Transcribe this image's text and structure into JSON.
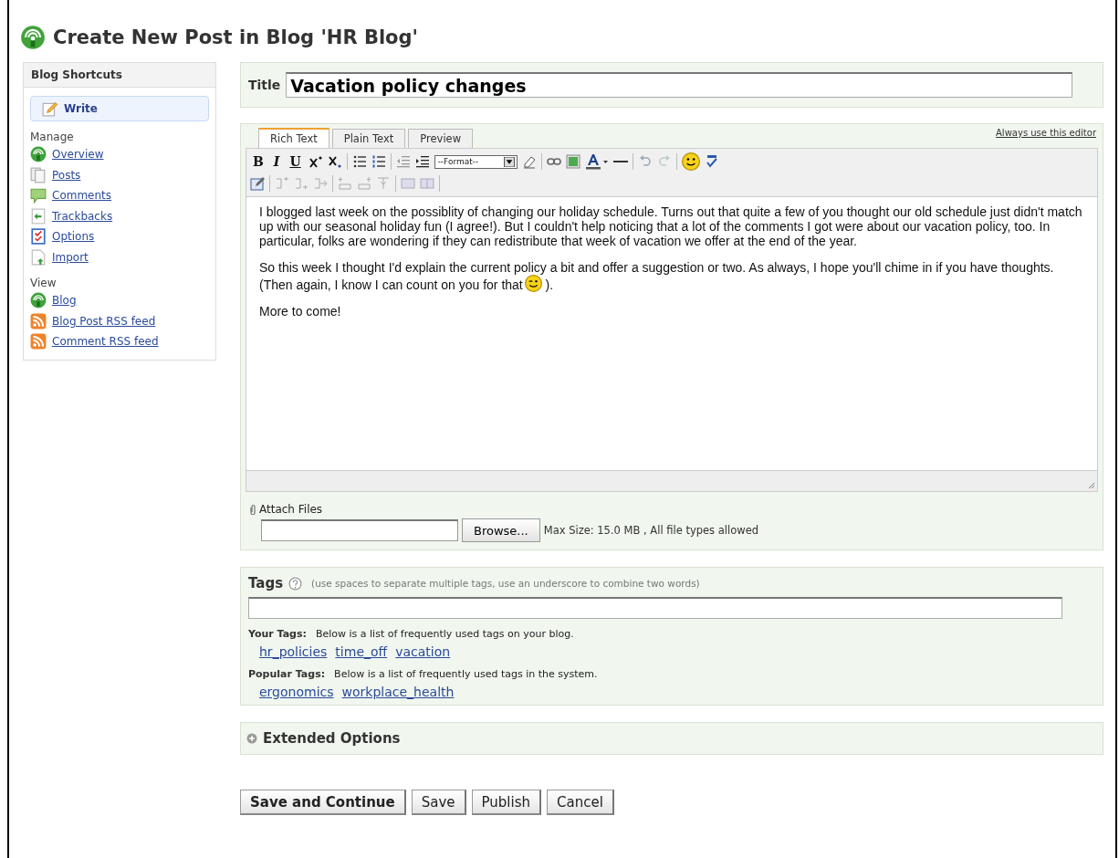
{
  "page_title": "Create New Post in Blog 'HR Blog'",
  "sidebar": {
    "heading": "Blog Shortcuts",
    "write": {
      "label": "Write",
      "selected": true
    },
    "sections": [
      {
        "label": "Manage",
        "items": [
          {
            "label": "Overview",
            "kind": "feed"
          },
          {
            "label": "Posts",
            "kind": "pages"
          },
          {
            "label": "Comments",
            "kind": "comment"
          },
          {
            "label": "Trackbacks",
            "kind": "trackback"
          },
          {
            "label": "Options",
            "kind": "options"
          },
          {
            "label": "Import",
            "kind": "import"
          }
        ]
      },
      {
        "label": "View",
        "items": [
          {
            "label": "Blog",
            "kind": "feed"
          },
          {
            "label": "Blog Post RSS feed",
            "kind": "rss"
          },
          {
            "label": "Comment RSS feed",
            "kind": "rss"
          }
        ]
      }
    ]
  },
  "title_field": {
    "label": "Title",
    "value": "Vacation policy changes"
  },
  "editor": {
    "tabs": [
      {
        "label": "Rich Text",
        "selected": true
      },
      {
        "label": "Plain Text",
        "selected": false
      },
      {
        "label": "Preview",
        "selected": false
      }
    ],
    "always_link": "Always use this editor",
    "format_select": "--Format--",
    "toolbar_letters": [
      "B",
      "I",
      "U"
    ],
    "paragraphs": [
      {
        "text": "I blogged last week on the possiblity of changing our holiday schedule. Turns out that quite a few of you thought our old schedule just didn't match up with our seasonal holiday fun (I agree!). But I couldn't help noticing that a lot of the comments I got were about our vacation policy, too. In particular, folks are wondering if they can redistribute that week of vacation we offer at the end of the year."
      },
      {
        "text": "So this week I thought I'd explain the current policy a bit and offer a suggestion or two. As always, I hope you'll chime in if you have thoughts. (Then again, I know I can count on you for that",
        "emoticon": true,
        "tail": ")."
      },
      {
        "text": "More to come!"
      }
    ]
  },
  "attach": {
    "label": "Attach Files",
    "button": "Browse...",
    "note": "Max Size: 15.0 MB , All file types allowed"
  },
  "tags": {
    "label": "Tags",
    "hint": "(use spaces to separate multiple tags, use an underscore to combine two words)",
    "groups": [
      {
        "label": "Your Tags:",
        "description": "Below is a list of frequently used tags on your blog.",
        "tags": [
          "hr_policies",
          "time_off",
          "vacation"
        ]
      },
      {
        "label": "Popular Tags:",
        "description": "Below is a list of frequently used tags in the system.",
        "tags": [
          "ergonomics",
          "workplace_health"
        ]
      }
    ]
  },
  "extended_options": {
    "label": "Extended Options",
    "expanded": false
  },
  "buttons": [
    {
      "label": "Save and Continue",
      "primary": true
    },
    {
      "label": "Save",
      "primary": false
    },
    {
      "label": "Publish",
      "primary": false
    },
    {
      "label": "Cancel",
      "primary": false
    }
  ]
}
